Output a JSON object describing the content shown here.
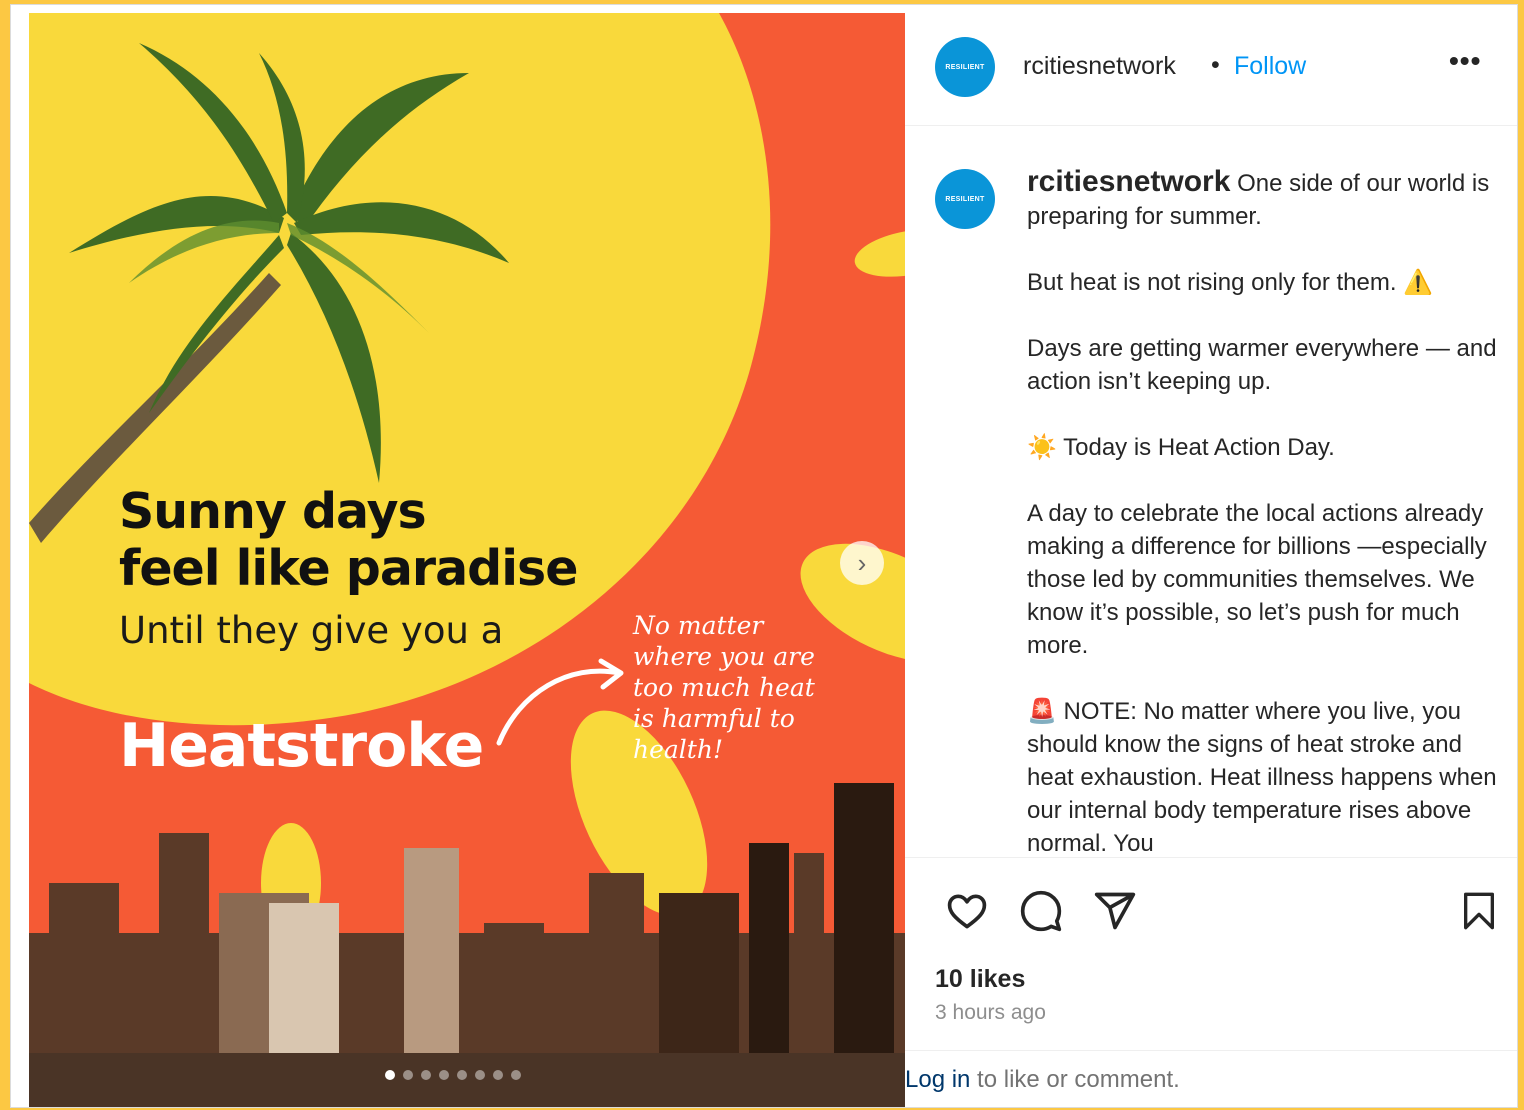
{
  "post": {
    "image": {
      "headline_line1": "Sunny days",
      "headline_line2": "feel like paradise",
      "subhead": "Until they give you a",
      "highlight": "Heatstroke",
      "callout": "No matter\nwhere you are\ntoo much heat\nis harmful to\nhealth!",
      "next_arrow": "›",
      "carousel_dots": 8,
      "carousel_active": 1,
      "colors": {
        "orange": "#f55a35",
        "yellow": "#f9d93b"
      }
    },
    "header": {
      "avatar_text": "RESILIENT",
      "username": "rcitiesnetwork",
      "separator": "•",
      "follow_label": "Follow",
      "more_label": "•••"
    },
    "caption": {
      "avatar_text": "RESILIENT",
      "username": "rcitiesnetwork",
      "p1": "One side of our world is preparing for summer.",
      "p2": "But heat is not rising only for them. ⚠️",
      "p3": "Days are getting warmer everywhere — and action isn’t keeping up.",
      "p4": "☀️ Today is Heat Action Day.",
      "p5": "A day to celebrate the local actions already making a difference for billions —especially those led by communities themselves. We know it’s possible, so let’s push for much more.",
      "p6": "🚨 NOTE: No matter where you live, you should know the signs of heat stroke and heat exhaustion. Heat illness happens when our internal body temperature rises above normal. You"
    },
    "actions": {
      "like_icon": "heart-icon",
      "comment_icon": "comment-icon",
      "share_icon": "share-icon",
      "save_icon": "bookmark-icon"
    },
    "likes": "10 likes",
    "timestamp": "3 hours ago",
    "login": {
      "link": "Log in",
      "rest": " to like or comment."
    },
    "accent_color": "#0095f6"
  }
}
